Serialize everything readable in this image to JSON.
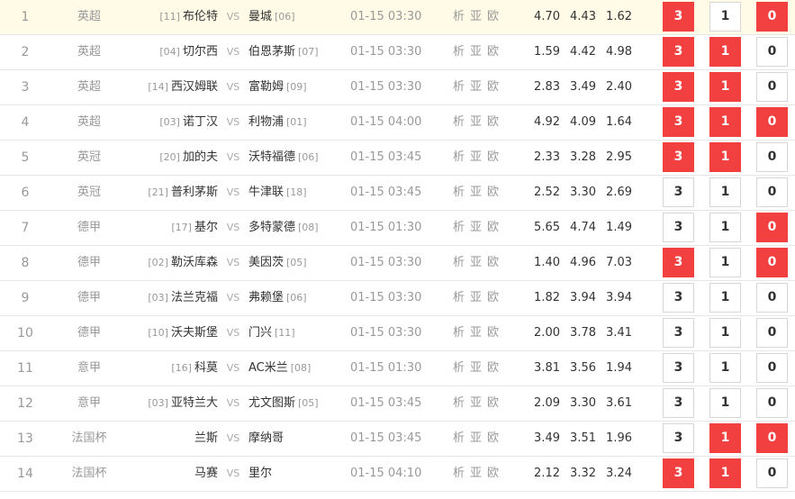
{
  "labels": {
    "vs": "VS",
    "link_analysis": "析",
    "link_asian": "亚",
    "link_euro": "欧"
  },
  "colors": {
    "selected_bg": "#f23f3f",
    "selected_text": "#ffffff",
    "highlight_row": "#fffbe6"
  },
  "matches": [
    {
      "index": "1",
      "league": "英超",
      "home_rank": "[11]",
      "home": "布伦特",
      "away": "曼城",
      "away_rank": "[06]",
      "time": "01-15 03:30",
      "odds": [
        "4.70",
        "4.43",
        "1.62"
      ],
      "picks": {
        "win": {
          "label": "3",
          "selected": true
        },
        "draw": {
          "label": "1",
          "selected": false
        },
        "loss": {
          "label": "0",
          "selected": true
        }
      }
    },
    {
      "index": "2",
      "league": "英超",
      "home_rank": "[04]",
      "home": "切尔西",
      "away": "伯恩茅斯",
      "away_rank": "[07]",
      "time": "01-15 03:30",
      "odds": [
        "1.59",
        "4.42",
        "4.98"
      ],
      "picks": {
        "win": {
          "label": "3",
          "selected": true
        },
        "draw": {
          "label": "1",
          "selected": true
        },
        "loss": {
          "label": "0",
          "selected": false
        }
      }
    },
    {
      "index": "3",
      "league": "英超",
      "home_rank": "[14]",
      "home": "西汉姆联",
      "away": "富勒姆",
      "away_rank": "[09]",
      "time": "01-15 03:30",
      "odds": [
        "2.83",
        "3.49",
        "2.40"
      ],
      "picks": {
        "win": {
          "label": "3",
          "selected": true
        },
        "draw": {
          "label": "1",
          "selected": true
        },
        "loss": {
          "label": "0",
          "selected": false
        }
      }
    },
    {
      "index": "4",
      "league": "英超",
      "home_rank": "[03]",
      "home": "诺丁汉",
      "away": "利物浦",
      "away_rank": "[01]",
      "time": "01-15 04:00",
      "odds": [
        "4.92",
        "4.09",
        "1.64"
      ],
      "picks": {
        "win": {
          "label": "3",
          "selected": true
        },
        "draw": {
          "label": "1",
          "selected": true
        },
        "loss": {
          "label": "0",
          "selected": true
        }
      }
    },
    {
      "index": "5",
      "league": "英冠",
      "home_rank": "[20]",
      "home": "加的夫",
      "away": "沃特福德",
      "away_rank": "[06]",
      "time": "01-15 03:45",
      "odds": [
        "2.33",
        "3.28",
        "2.95"
      ],
      "picks": {
        "win": {
          "label": "3",
          "selected": true
        },
        "draw": {
          "label": "1",
          "selected": true
        },
        "loss": {
          "label": "0",
          "selected": false
        }
      }
    },
    {
      "index": "6",
      "league": "英冠",
      "home_rank": "[21]",
      "home": "普利茅斯",
      "away": "牛津联",
      "away_rank": "[18]",
      "time": "01-15 03:45",
      "odds": [
        "2.52",
        "3.30",
        "2.69"
      ],
      "picks": {
        "win": {
          "label": "3",
          "selected": false
        },
        "draw": {
          "label": "1",
          "selected": false
        },
        "loss": {
          "label": "0",
          "selected": false
        }
      }
    },
    {
      "index": "7",
      "league": "德甲",
      "home_rank": "[17]",
      "home": "基尔",
      "away": "多特蒙德",
      "away_rank": "[08]",
      "time": "01-15 01:30",
      "odds": [
        "5.65",
        "4.74",
        "1.49"
      ],
      "picks": {
        "win": {
          "label": "3",
          "selected": false
        },
        "draw": {
          "label": "1",
          "selected": false
        },
        "loss": {
          "label": "0",
          "selected": true
        }
      }
    },
    {
      "index": "8",
      "league": "德甲",
      "home_rank": "[02]",
      "home": "勒沃库森",
      "away": "美因茨",
      "away_rank": "[05]",
      "time": "01-15 03:30",
      "odds": [
        "1.40",
        "4.96",
        "7.03"
      ],
      "picks": {
        "win": {
          "label": "3",
          "selected": true
        },
        "draw": {
          "label": "1",
          "selected": false
        },
        "loss": {
          "label": "0",
          "selected": true
        }
      }
    },
    {
      "index": "9",
      "league": "德甲",
      "home_rank": "[03]",
      "home": "法兰克福",
      "away": "弗赖堡",
      "away_rank": "[06]",
      "time": "01-15 03:30",
      "odds": [
        "1.82",
        "3.94",
        "3.94"
      ],
      "picks": {
        "win": {
          "label": "3",
          "selected": false
        },
        "draw": {
          "label": "1",
          "selected": false
        },
        "loss": {
          "label": "0",
          "selected": false
        }
      }
    },
    {
      "index": "10",
      "league": "德甲",
      "home_rank": "[10]",
      "home": "沃夫斯堡",
      "away": "门兴",
      "away_rank": "[11]",
      "time": "01-15 03:30",
      "odds": [
        "2.00",
        "3.78",
        "3.41"
      ],
      "picks": {
        "win": {
          "label": "3",
          "selected": false
        },
        "draw": {
          "label": "1",
          "selected": false
        },
        "loss": {
          "label": "0",
          "selected": false
        }
      }
    },
    {
      "index": "11",
      "league": "意甲",
      "home_rank": "[16]",
      "home": "科莫",
      "away": "AC米兰",
      "away_rank": "[08]",
      "time": "01-15 01:30",
      "odds": [
        "3.81",
        "3.56",
        "1.94"
      ],
      "picks": {
        "win": {
          "label": "3",
          "selected": false
        },
        "draw": {
          "label": "1",
          "selected": false
        },
        "loss": {
          "label": "0",
          "selected": false
        }
      }
    },
    {
      "index": "12",
      "league": "意甲",
      "home_rank": "[03]",
      "home": "亚特兰大",
      "away": "尤文图斯",
      "away_rank": "[05]",
      "time": "01-15 03:45",
      "odds": [
        "2.09",
        "3.30",
        "3.61"
      ],
      "picks": {
        "win": {
          "label": "3",
          "selected": false
        },
        "draw": {
          "label": "1",
          "selected": false
        },
        "loss": {
          "label": "0",
          "selected": false
        }
      }
    },
    {
      "index": "13",
      "league": "法国杯",
      "home_rank": "",
      "home": "兰斯",
      "away": "摩纳哥",
      "away_rank": "",
      "time": "01-15 03:45",
      "odds": [
        "3.49",
        "3.51",
        "1.96"
      ],
      "picks": {
        "win": {
          "label": "3",
          "selected": false
        },
        "draw": {
          "label": "1",
          "selected": true
        },
        "loss": {
          "label": "0",
          "selected": true
        }
      }
    },
    {
      "index": "14",
      "league": "法国杯",
      "home_rank": "",
      "home": "马赛",
      "away": "里尔",
      "away_rank": "",
      "time": "01-15 04:10",
      "odds": [
        "2.12",
        "3.32",
        "3.24"
      ],
      "picks": {
        "win": {
          "label": "3",
          "selected": true
        },
        "draw": {
          "label": "1",
          "selected": true
        },
        "loss": {
          "label": "0",
          "selected": false
        }
      }
    }
  ]
}
